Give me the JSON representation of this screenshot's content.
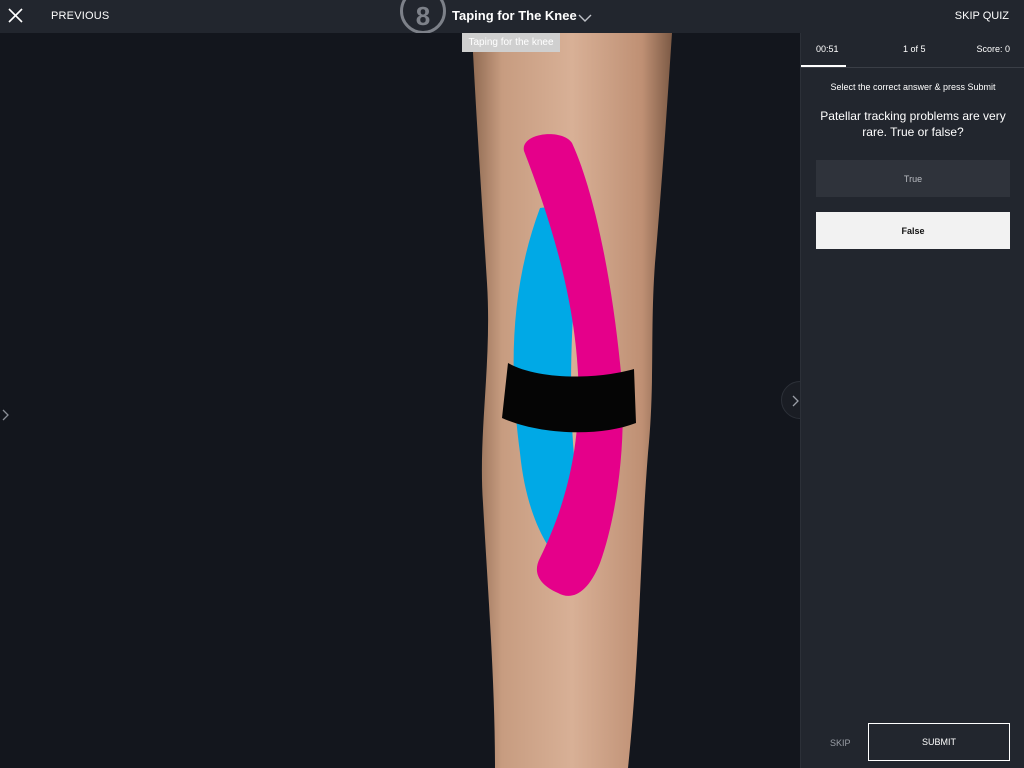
{
  "header": {
    "close_icon": "close-icon",
    "previous_label": "PREVIOUS",
    "lesson_number": "8",
    "lesson_title": "Taping for The Knee",
    "skip_quiz_label": "SKIP QUIZ",
    "tooltip": "Taping for the knee"
  },
  "quiz": {
    "timer": "00:51",
    "progress": "1 of 5",
    "score": "Score: 0",
    "instruction": "Select the correct answer & press Submit",
    "question": "Patellar tracking problems are very rare. True or false?",
    "answers": [
      {
        "label": "True",
        "selected": false
      },
      {
        "label": "False",
        "selected": true
      }
    ],
    "skip_label": "SKIP",
    "submit_label": "SUBMIT"
  },
  "colors": {
    "tape_pink": "#e5008a",
    "tape_blue": "#00a9e6",
    "tape_black": "#050505",
    "skin": "#c89a7c",
    "panel": "#22262e",
    "background": "#13161d"
  }
}
